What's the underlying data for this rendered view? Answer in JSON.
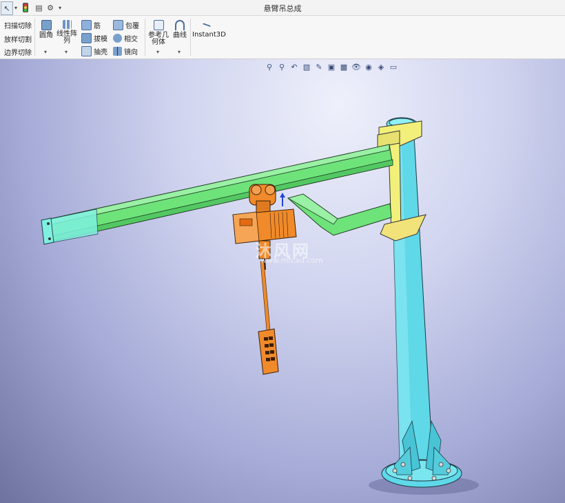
{
  "window": {
    "title": "悬臂吊总成"
  },
  "quick_access": {
    "select_icon": "cursor-arrow-icon",
    "traffic_icon": "traffic-light-icon",
    "options_icon": "gear-icon"
  },
  "ribbon": {
    "sweep_cut": "扫描切除",
    "loft_cut": "放样切割",
    "boundary_cut": "边界切除",
    "fillet": "圆角",
    "linear_pattern_line1": "线性阵",
    "linear_pattern_line2": "列",
    "rib": "筋",
    "draft": "拔模",
    "shell": "抽壳",
    "wrap": "包覆",
    "intersect": "相交",
    "mirror": "镜向",
    "ref_geom_line1": "参考几",
    "ref_geom_line2": "何体",
    "curves": "曲线",
    "instant3d": "Instant3D"
  },
  "watermark": {
    "main": "沐风网",
    "sub": "www.mfcad.com"
  },
  "colors": {
    "beam": "#6ee37a",
    "beam_end": "#7ff0e0",
    "column": "#5fd8e8",
    "bracket": "#f2f07a",
    "hoist": "#f08a2a"
  }
}
